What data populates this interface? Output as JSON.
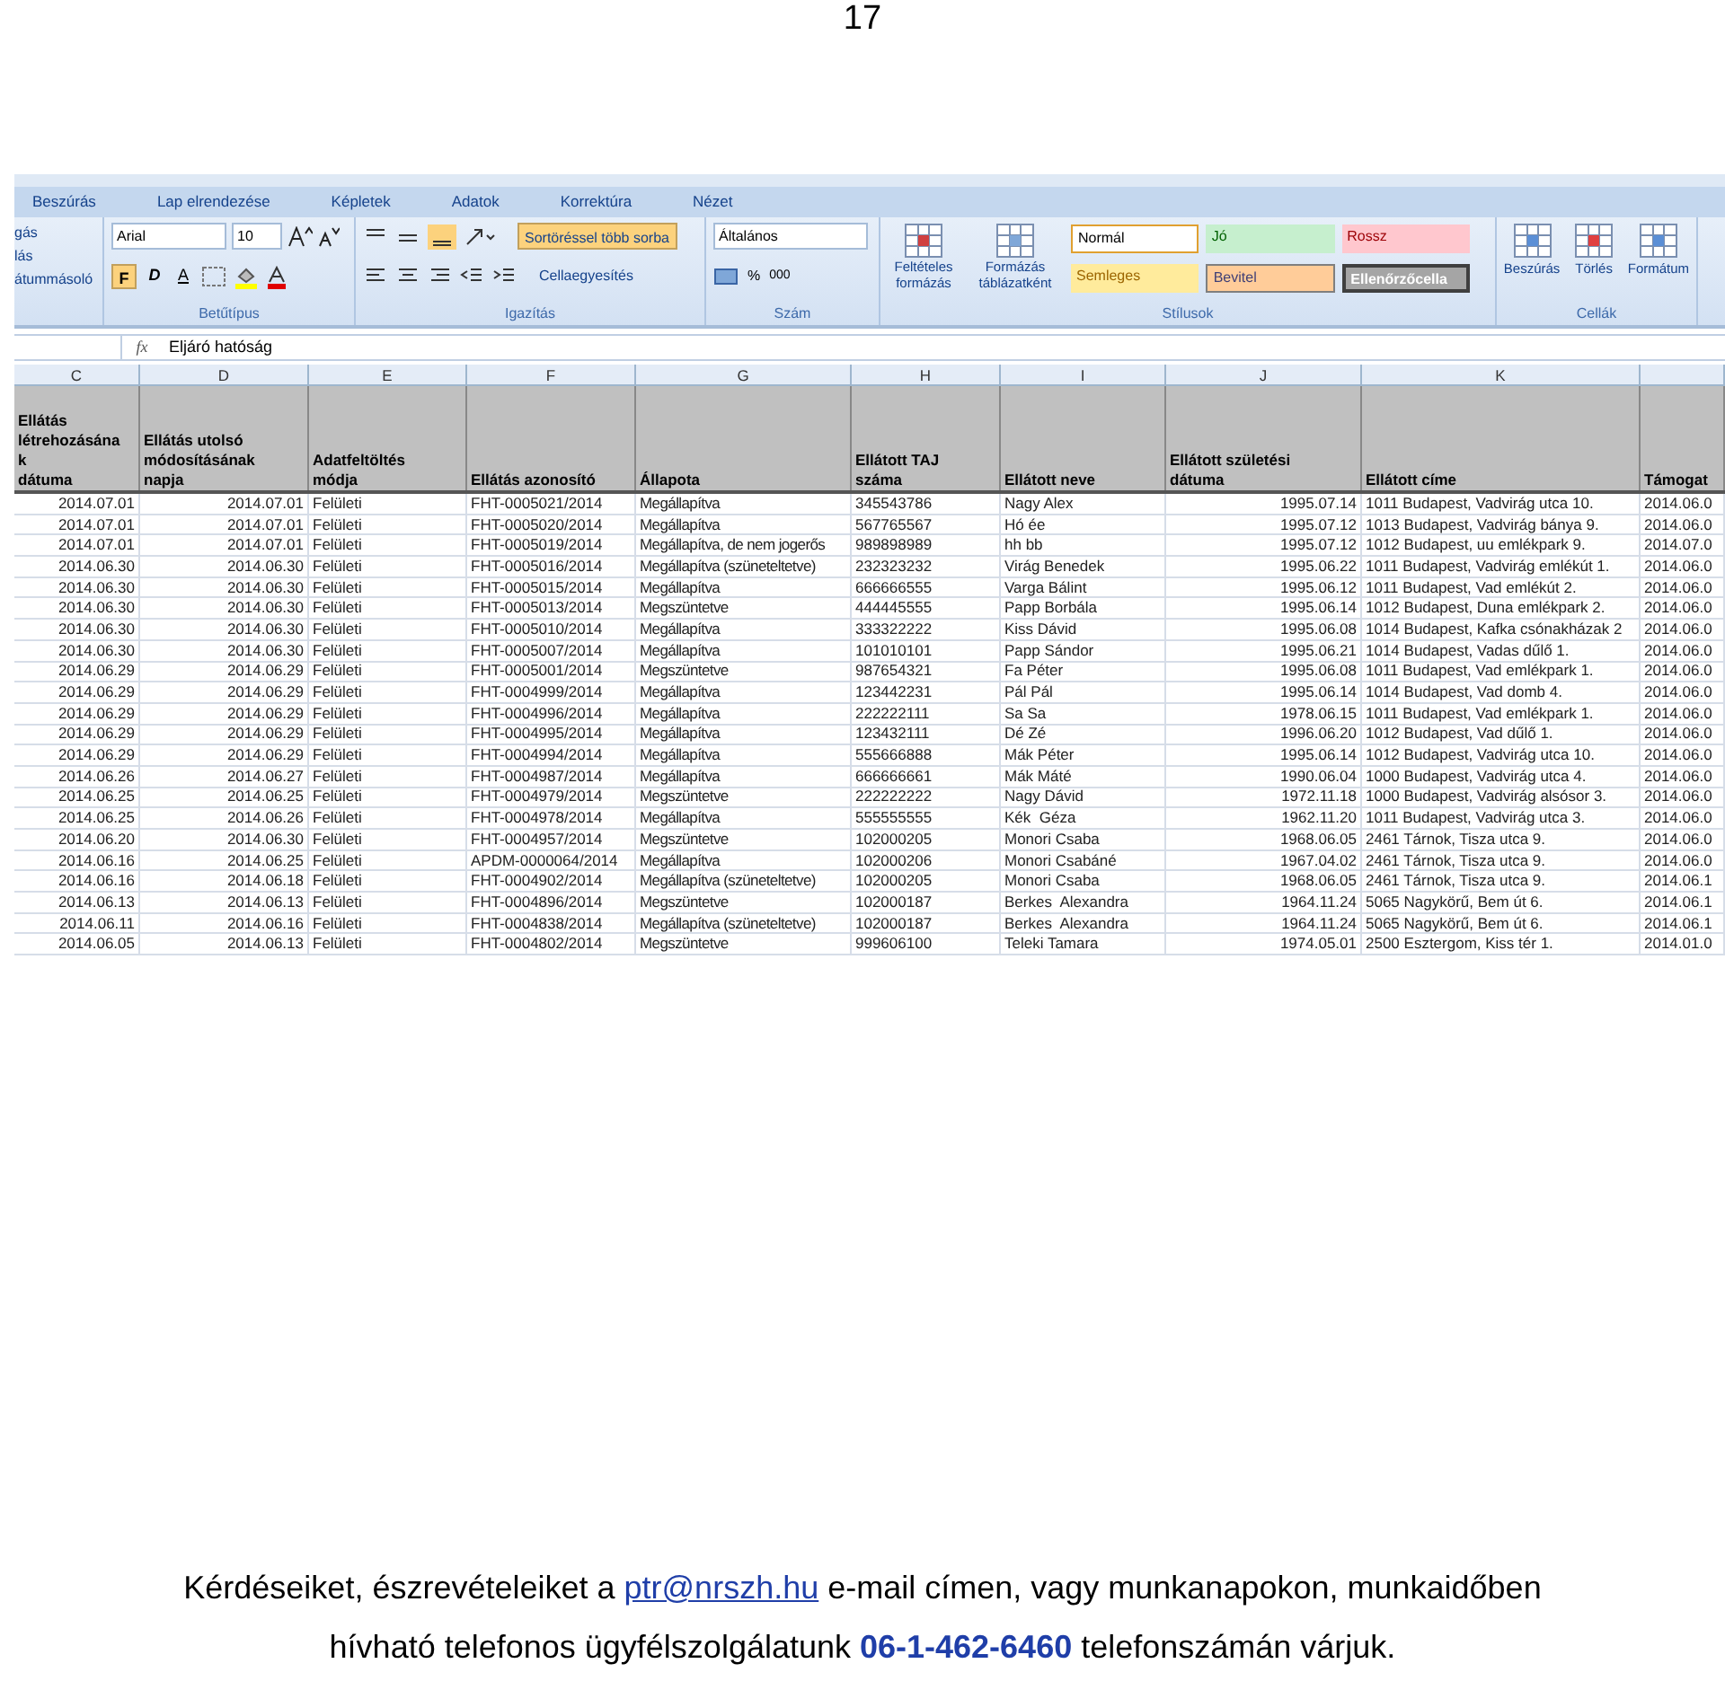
{
  "page_number": "17",
  "excel": {
    "tabs": [
      {
        "label": "Beszúrás",
        "selected": false
      },
      {
        "label": "Lap elrendezése",
        "selected": false
      },
      {
        "label": "Képletek",
        "selected": false
      },
      {
        "label": "Adatok",
        "selected": false
      },
      {
        "label": "Korrektúra",
        "selected": false
      },
      {
        "label": "Nézet",
        "selected": false
      }
    ],
    "clipboard": {
      "items": [
        "gás",
        "lás",
        "átummásoló"
      ]
    },
    "font_group": {
      "label": "Betűtípus",
      "font": "Arial",
      "size": "10",
      "bold": "F",
      "bold_on": true,
      "italic": "D",
      "underline": "A"
    },
    "align_group": {
      "label": "Igazítás",
      "align_bottom_on": true,
      "wrap": "Sortöréssel több sorba",
      "wrap_on": true,
      "merge": "Cellaegyesítés"
    },
    "number_group": {
      "label": "Szám",
      "format": "Általános",
      "percent": "%",
      "thousands": "000"
    },
    "styles_group": {
      "label": "Stílusok",
      "conditional": "Feltételes formázás",
      "as_table": "Formázás táblázatként",
      "styles": [
        {
          "label": "Normál",
          "kind": "normal"
        },
        {
          "label": "Jó",
          "kind": "good"
        },
        {
          "label": "Rossz",
          "kind": "bad"
        },
        {
          "label": "Semleges",
          "kind": "neutral"
        },
        {
          "label": "Bevitel",
          "kind": "input"
        },
        {
          "label": "Ellenőrzőcella",
          "kind": "check"
        }
      ]
    },
    "cells_group": {
      "label": "Cellák",
      "buttons": [
        "Beszúrás",
        "Törlés",
        "Formátum"
      ]
    },
    "formula_bar": {
      "fx": "fx",
      "value": "Eljáró hatóság"
    },
    "column_letters": [
      "C",
      "D",
      "E",
      "F",
      "G",
      "H",
      "I",
      "J",
      "K"
    ],
    "headers": [
      "Ellátás\nlétrehozásána\nk\ndátuma",
      "Ellátás utolsó\nmódosításának\nnapja",
      "Adatfeltöltés\nmódja",
      "Ellátás azonosító",
      "Állapota",
      "Ellátott TAJ\nszáma",
      "Ellátott neve",
      "Ellátott születési\ndátuma",
      "Ellátott címe",
      "Támogat"
    ],
    "rows": [
      [
        "2014.07.01",
        "2014.07.01",
        "Felületi",
        "FHT-0005021/2014",
        "Megállapítva",
        "345543786",
        "Nagy Alex",
        "1995.07.14",
        "1011 Budapest, Vadvirág utca 10.",
        "2014.06.0"
      ],
      [
        "2014.07.01",
        "2014.07.01",
        "Felületi",
        "FHT-0005020/2014",
        "Megállapítva",
        "567765567",
        "Hó ée",
        "1995.07.12",
        "1013 Budapest, Vadvirág bánya 9.",
        "2014.06.0"
      ],
      [
        "2014.07.01",
        "2014.07.01",
        "Felületi",
        "FHT-0005019/2014",
        "Megállapítva, de nem jogerős",
        "989898989",
        "hh bb",
        "1995.07.12",
        "1012 Budapest, uu emlékpark 9.",
        "2014.07.0"
      ],
      [
        "2014.06.30",
        "2014.06.30",
        "Felületi",
        "FHT-0005016/2014",
        "Megállapítva (szüneteltetve)",
        "232323232",
        "Virág Benedek",
        "1995.06.22",
        "1011 Budapest, Vadvirág emlékút 1.",
        "2014.06.0"
      ],
      [
        "2014.06.30",
        "2014.06.30",
        "Felületi",
        "FHT-0005015/2014",
        "Megállapítva",
        "666666555",
        "Varga Bálint",
        "1995.06.12",
        "1011 Budapest, Vad emlékút 2.",
        "2014.06.0"
      ],
      [
        "2014.06.30",
        "2014.06.30",
        "Felületi",
        "FHT-0005013/2014",
        "Megszüntetve",
        "444445555",
        "Papp Borbála",
        "1995.06.14",
        "1012 Budapest, Duna emlékpark 2.",
        "2014.06.0"
      ],
      [
        "2014.06.30",
        "2014.06.30",
        "Felületi",
        "FHT-0005010/2014",
        "Megállapítva",
        "333322222",
        "Kiss Dávid",
        "1995.06.08",
        "1014 Budapest, Kafka csónakházak 2",
        "2014.06.0"
      ],
      [
        "2014.06.30",
        "2014.06.30",
        "Felületi",
        "FHT-0005007/2014",
        "Megállapítva",
        "101010101",
        "Papp Sándor",
        "1995.06.21",
        "1014 Budapest, Vadas dűlő 1.",
        "2014.06.0"
      ],
      [
        "2014.06.29",
        "2014.06.29",
        "Felületi",
        "FHT-0005001/2014",
        "Megszüntetve",
        "987654321",
        "Fa Péter",
        "1995.06.08",
        "1011 Budapest, Vad emlékpark 1.",
        "2014.06.0"
      ],
      [
        "2014.06.29",
        "2014.06.29",
        "Felületi",
        "FHT-0004999/2014",
        "Megállapítva",
        "123442231",
        "Pál Pál",
        "1995.06.14",
        "1014 Budapest, Vad domb 4.",
        "2014.06.0"
      ],
      [
        "2014.06.29",
        "2014.06.29",
        "Felületi",
        "FHT-0004996/2014",
        "Megállapítva",
        "222222111",
        "Sa Sa",
        "1978.06.15",
        "1011 Budapest, Vad emlékpark 1.",
        "2014.06.0"
      ],
      [
        "2014.06.29",
        "2014.06.29",
        "Felületi",
        "FHT-0004995/2014",
        "Megállapítva",
        "123432111",
        "Dé Zé",
        "1996.06.20",
        "1012 Budapest, Vad dűlő 1.",
        "2014.06.0"
      ],
      [
        "2014.06.29",
        "2014.06.29",
        "Felületi",
        "FHT-0004994/2014",
        "Megállapítva",
        "555666888",
        "Mák Péter",
        "1995.06.14",
        "1012 Budapest, Vadvirág utca 10.",
        "2014.06.0"
      ],
      [
        "2014.06.26",
        "2014.06.27",
        "Felületi",
        "FHT-0004987/2014",
        "Megállapítva",
        "666666661",
        "Mák Máté",
        "1990.06.04",
        "1000 Budapest, Vadvirág utca 4.",
        "2014.06.0"
      ],
      [
        "2014.06.25",
        "2014.06.25",
        "Felületi",
        "FHT-0004979/2014",
        "Megszüntetve",
        "222222222",
        "Nagy Dávid",
        "1972.11.18",
        "1000 Budapest, Vadvirág alsósor 3.",
        "2014.06.0"
      ],
      [
        "2014.06.25",
        "2014.06.26",
        "Felületi",
        "FHT-0004978/2014",
        "Megállapítva",
        "555555555",
        "Kék  Géza",
        "1962.11.20",
        "1011 Budapest, Vadvirág utca 3.",
        "2014.06.0"
      ],
      [
        "2014.06.20",
        "2014.06.30",
        "Felületi",
        "FHT-0004957/2014",
        "Megszüntetve",
        "102000205",
        "Monori Csaba",
        "1968.06.05",
        "2461 Tárnok, Tisza utca 9.",
        "2014.06.0"
      ],
      [
        "2014.06.16",
        "2014.06.25",
        "Felületi",
        "APDM-0000064/2014",
        "Megállapítva",
        "102000206",
        "Monori Csabáné",
        "1967.04.02",
        "2461 Tárnok, Tisza utca 9.",
        "2014.06.0"
      ],
      [
        "2014.06.16",
        "2014.06.18",
        "Felületi",
        "FHT-0004902/2014",
        "Megállapítva (szüneteltetve)",
        "102000205",
        "Monori Csaba",
        "1968.06.05",
        "2461 Tárnok, Tisza utca 9.",
        "2014.06.1"
      ],
      [
        "2014.06.13",
        "2014.06.13",
        "Felületi",
        "FHT-0004896/2014",
        "Megszüntetve",
        "102000187",
        "Berkes  Alexandra",
        "1964.11.24",
        "5065 Nagykörű, Bem út 6.",
        "2014.06.1"
      ],
      [
        "2014.06.11",
        "2014.06.16",
        "Felületi",
        "FHT-0004838/2014",
        "Megállapítva (szüneteltetve)",
        "102000187",
        "Berkes  Alexandra",
        "1964.11.24",
        "5065 Nagykörű, Bem út 6.",
        "2014.06.1"
      ],
      [
        "2014.06.05",
        "2014.06.13",
        "Felületi",
        "FHT-0004802/2014",
        "Megszüntetve",
        "999606100",
        "Teleki Tamara",
        "1974.05.01",
        "2500 Esztergom, Kiss tér 1.",
        "2014.01.0"
      ]
    ]
  },
  "footer": {
    "text_before": "Kérdéseiket, észrevételeiket a ",
    "email": "ptr@nrszh.hu",
    "text_after": " e-mail címen, vagy munkanapokon, munkaidőben",
    "line_2": "hívható telefonos ügyfélszolgálatunk **06-1-462-6460** telefonszámán várjuk."
  }
}
